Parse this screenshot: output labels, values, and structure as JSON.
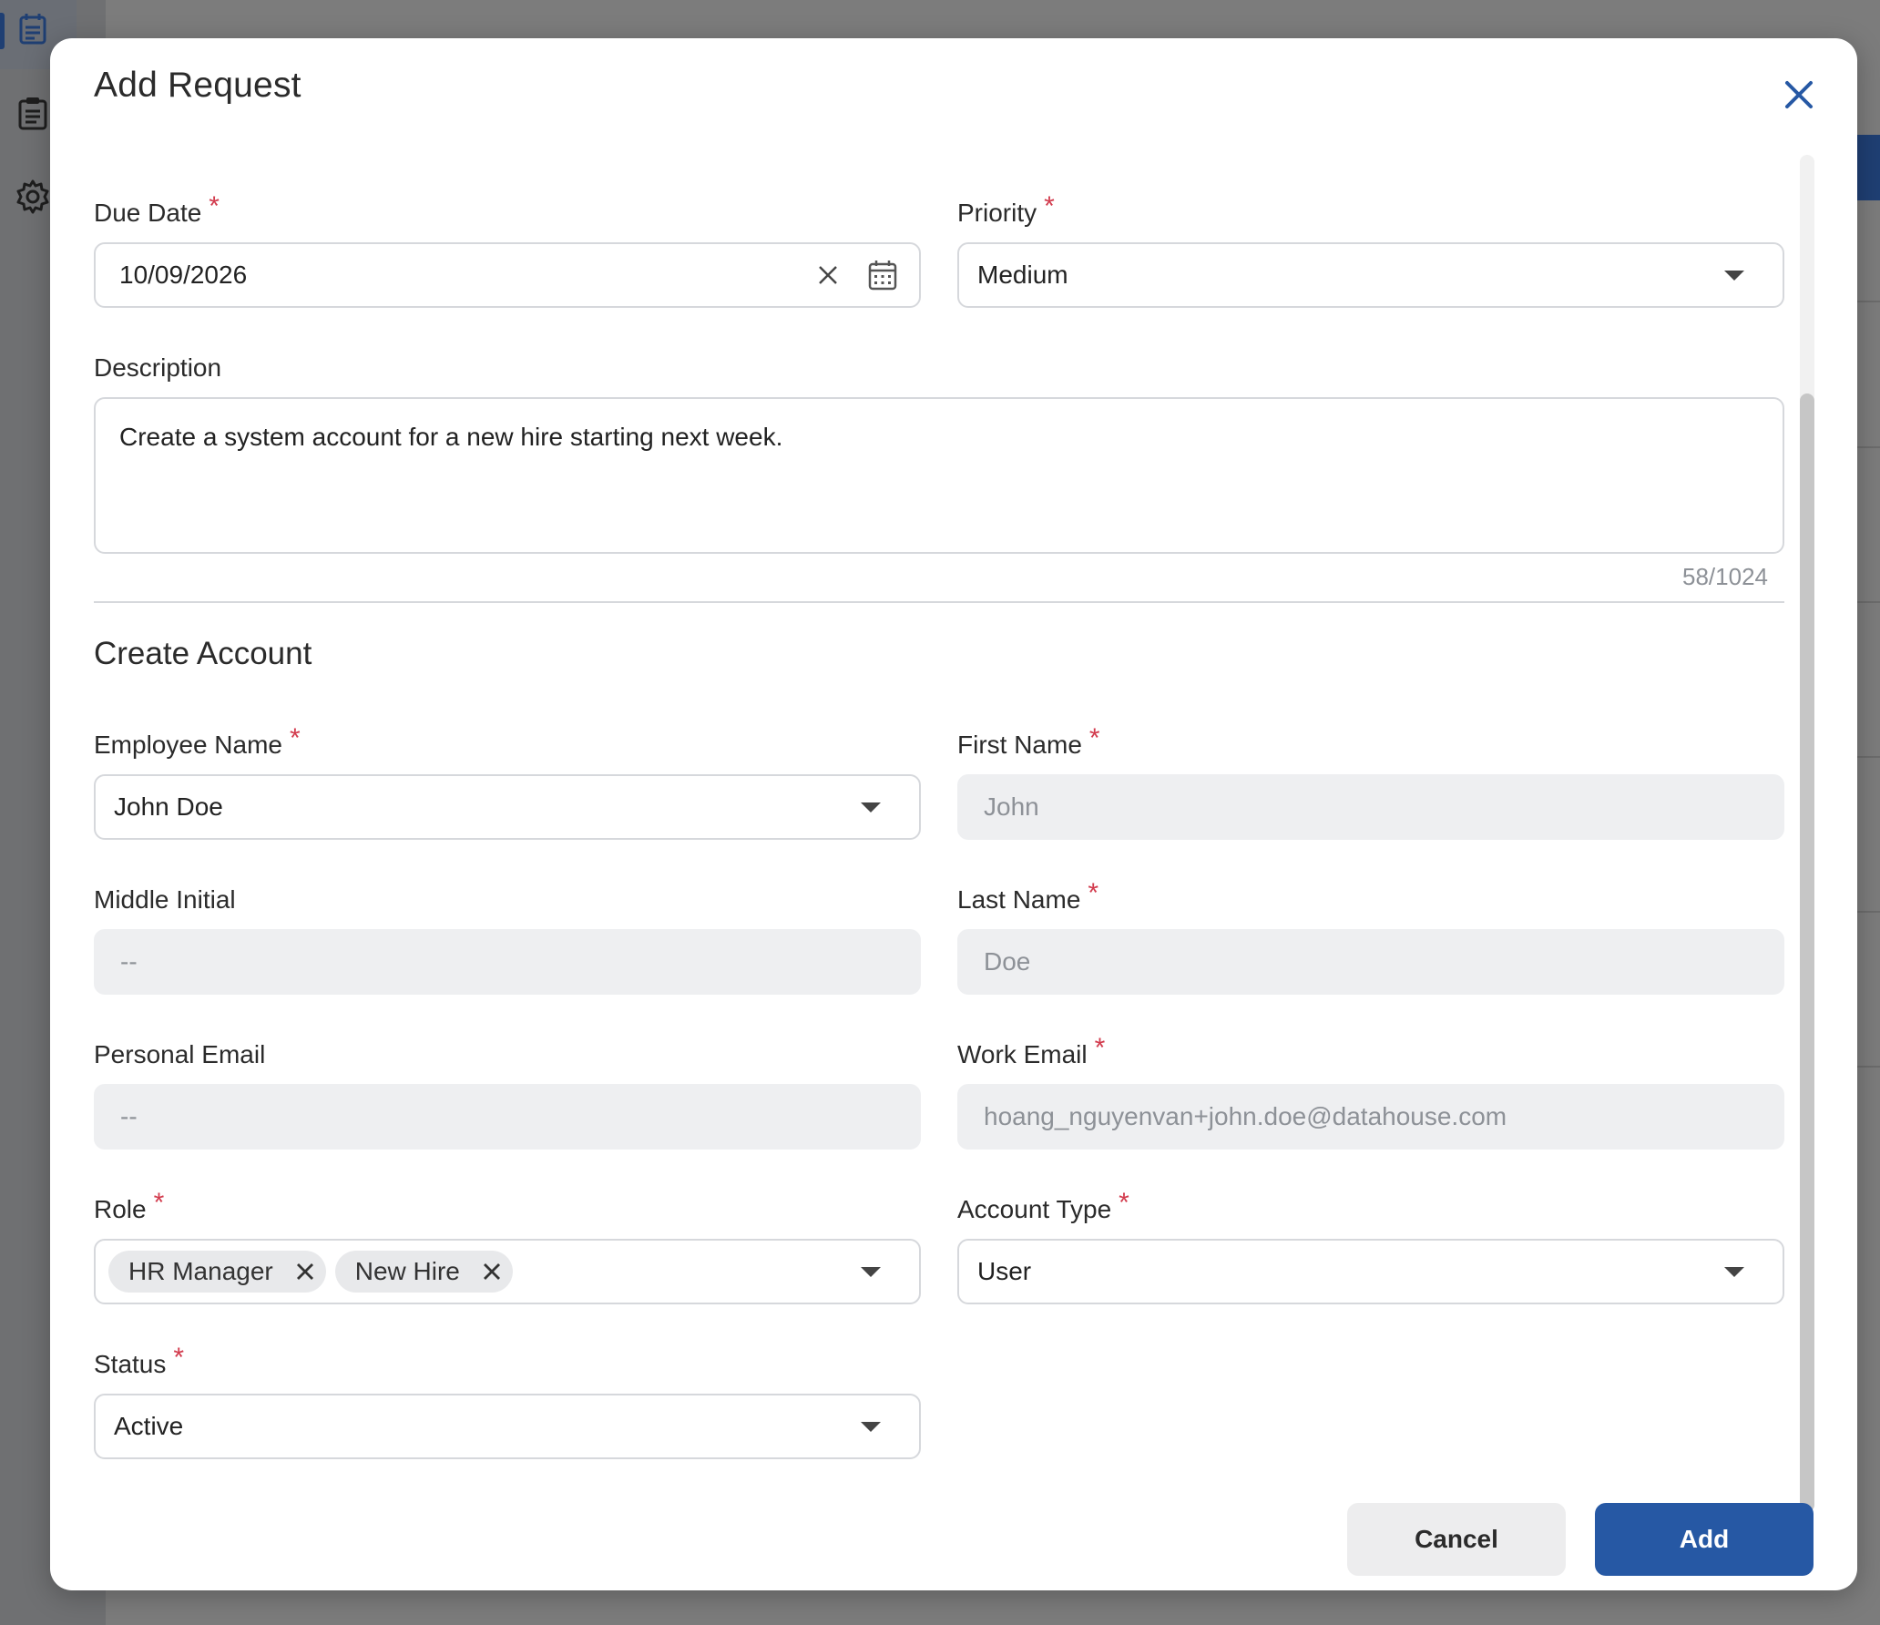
{
  "modal": {
    "title": "Add Request"
  },
  "request": {
    "due_date_label": "Due Date",
    "due_date_value": "10/09/2026",
    "priority_label": "Priority",
    "priority_value": "Medium",
    "description_label": "Description",
    "description_value": "Create a system account for a new hire starting next week.",
    "description_counter": "58/1024"
  },
  "account": {
    "section_title": "Create Account",
    "employee_name_label": "Employee Name",
    "employee_name_value": "John Doe",
    "first_name_label": "First Name",
    "first_name_value": "John",
    "middle_initial_label": "Middle Initial",
    "middle_initial_value": "--",
    "last_name_label": "Last Name",
    "last_name_value": "Doe",
    "personal_email_label": "Personal Email",
    "personal_email_value": "--",
    "work_email_label": "Work Email",
    "work_email_value": "hoang_nguyenvan+john.doe@datahouse.com",
    "role_label": "Role",
    "roles": [
      "HR Manager",
      "New Hire"
    ],
    "account_type_label": "Account Type",
    "account_type_value": "User",
    "status_label": "Status",
    "status_value": "Active"
  },
  "required_marker": "*",
  "footer": {
    "cancel_label": "Cancel",
    "add_label": "Add"
  },
  "colors": {
    "primary": "#2658a4",
    "required": "#d23b4d",
    "readonly_bg": "#eeeff1"
  },
  "icons": {
    "sidebar": [
      "calendar-list-icon",
      "clipboard-icon",
      "gear-icon"
    ],
    "close": "close-icon",
    "clear": "clear-icon",
    "calendar": "calendar-icon",
    "dropdown": "chevron-down-icon"
  }
}
